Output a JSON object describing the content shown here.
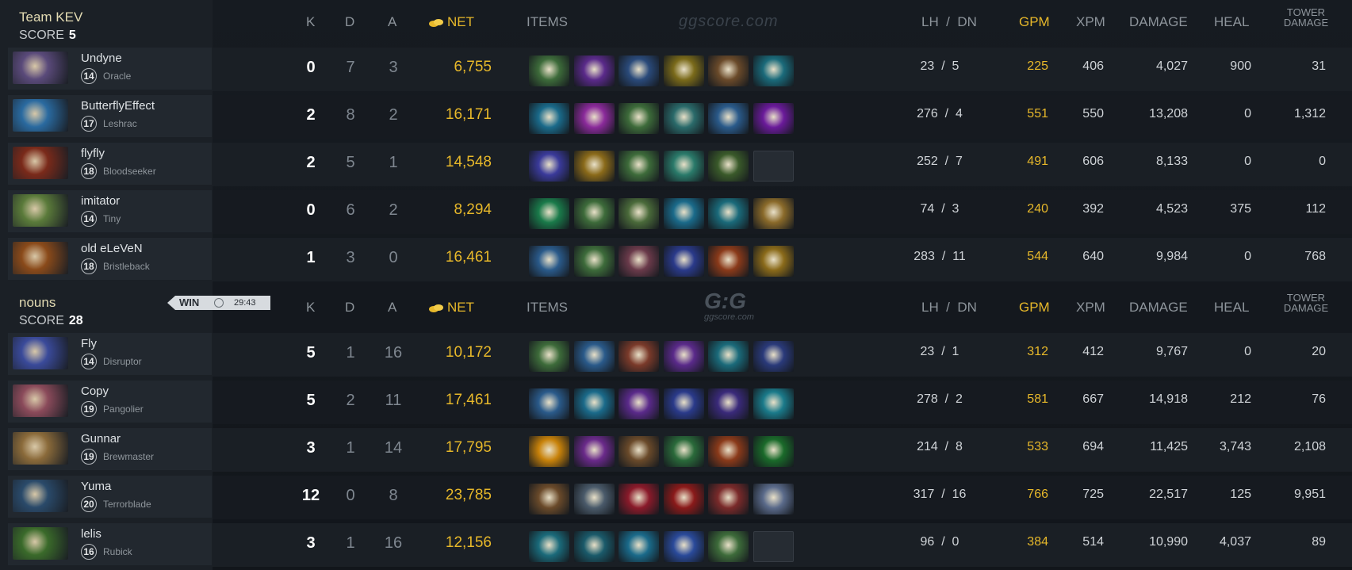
{
  "colors": {
    "gold": "#e7b82a",
    "win_badge": "#d7dbdf"
  },
  "watermark": "ggscore.com",
  "logo": {
    "mark": "G:G",
    "sub": "ggscore.com"
  },
  "win_badge": {
    "label": "WIN",
    "time": "29:43",
    "icon": "clock-icon"
  },
  "columns": {
    "k": "K",
    "d": "D",
    "a": "A",
    "net": "NET",
    "net_icon": "gold-coins-icon",
    "items": "ITEMS",
    "lh_dn": "LH  /  DN",
    "gpm": "GPM",
    "xpm": "XPM",
    "damage": "DAMAGE",
    "heal": "HEAL",
    "tower_damage_1": "TOWER",
    "tower_damage_2": "DAMAGE"
  },
  "teams": [
    {
      "name": "Team  KEV",
      "score_label": "SCORE",
      "score": "5",
      "players": [
        {
          "name": "Undyne",
          "level": "14",
          "hero": "Oracle",
          "hero_color": "#5a4a7a",
          "k": "0",
          "d": "7",
          "a": "3",
          "net": "6,755",
          "lh_dn": "23  /  5",
          "gpm": "225",
          "xpm": "406",
          "damage": "4,027",
          "heal": "900",
          "tower": "31",
          "items": [
            "#3d6b3a",
            "#5a2a8a",
            "#2a4a7a",
            "#7a6a1a",
            "#6a4a2a",
            "#1a6a7a"
          ]
        },
        {
          "name": "ButterflyEffect",
          "level": "17",
          "hero": "Leshrac",
          "hero_color": "#2a6aa0",
          "k": "2",
          "d": "8",
          "a": "2",
          "net": "16,171",
          "lh_dn": "276  /  4",
          "gpm": "551",
          "xpm": "550",
          "damage": "13,208",
          "heal": "0",
          "tower": "1,312",
          "items": [
            "#1a6a8a",
            "#8a2a9a",
            "#3d6b3a",
            "#2a6a6a",
            "#2a5a8a",
            "#6a1a9a"
          ]
        },
        {
          "name": "flyfly",
          "level": "18",
          "hero": "Bloodseeker",
          "hero_color": "#7a2a1a",
          "k": "2",
          "d": "5",
          "a": "1",
          "net": "14,548",
          "lh_dn": "252  /  7",
          "gpm": "491",
          "xpm": "606",
          "damage": "8,133",
          "heal": "0",
          "tower": "0",
          "items": [
            "#3a3a9a",
            "#8a6a1a",
            "#3d6b3a",
            "#2a7a6a",
            "#3a5a2a",
            "empty"
          ]
        },
        {
          "name": "imitator",
          "level": "14",
          "hero": "Tiny",
          "hero_color": "#5a7a3a",
          "k": "0",
          "d": "6",
          "a": "2",
          "net": "8,294",
          "lh_dn": "74  /  3",
          "gpm": "240",
          "xpm": "392",
          "damage": "4,523",
          "heal": "375",
          "tower": "112",
          "items": [
            "#1a7a4a",
            "#3d6b3a",
            "#4a6a3a",
            "#1a6a8a",
            "#1a6a7a",
            "#8a6a2a"
          ]
        },
        {
          "name": "old eLeVeN",
          "level": "18",
          "hero": "Bristleback",
          "hero_color": "#8a4a1a",
          "k": "1",
          "d": "3",
          "a": "0",
          "net": "16,461",
          "lh_dn": "283  /  11",
          "gpm": "544",
          "xpm": "640",
          "damage": "9,984",
          "heal": "0",
          "tower": "768",
          "items": [
            "#2a5a8a",
            "#3d6b3a",
            "#6a3a4a",
            "#2a3a8a",
            "#8a3a1a",
            "#8a6a1a"
          ]
        }
      ]
    },
    {
      "name": "nouns",
      "score_label": "SCORE",
      "score": "28",
      "players": [
        {
          "name": "Fly",
          "level": "14",
          "hero": "Disruptor",
          "hero_color": "#3a4a9a",
          "k": "5",
          "d": "1",
          "a": "16",
          "net": "10,172",
          "lh_dn": "23  /  1",
          "gpm": "312",
          "xpm": "412",
          "damage": "9,767",
          "heal": "0",
          "tower": "20",
          "items": [
            "#3d6b3a",
            "#2a5a8a",
            "#7a3a2a",
            "#5a2a8a",
            "#1a6a7a",
            "#2a3a7a"
          ]
        },
        {
          "name": "Copy",
          "level": "19",
          "hero": "Pangolier",
          "hero_color": "#8a4a5a",
          "k": "5",
          "d": "2",
          "a": "11",
          "net": "17,461",
          "lh_dn": "278  /  2",
          "gpm": "581",
          "xpm": "667",
          "damage": "14,918",
          "heal": "212",
          "tower": "76",
          "items": [
            "#2a5a8a",
            "#1a6a8a",
            "#5a2a8a",
            "#2a3a8a",
            "#3a2a7a",
            "#1a7a8a"
          ]
        },
        {
          "name": "Gunnar",
          "level": "19",
          "hero": "Brewmaster",
          "hero_color": "#8a6a3a",
          "k": "3",
          "d": "1",
          "a": "14",
          "net": "17,795",
          "lh_dn": "214  /  8",
          "gpm": "533",
          "xpm": "694",
          "damage": "11,425",
          "heal": "3,743",
          "tower": "2,108",
          "items": [
            "#c8820a",
            "#6a2a8a",
            "#6a4a2a",
            "#2a6a3a",
            "#8a3a1a",
            "#1a6a2a"
          ]
        },
        {
          "name": "Yuma",
          "level": "20",
          "hero": "Terrorblade",
          "hero_color": "#2a4a6a",
          "k": "12",
          "d": "0",
          "a": "8",
          "net": "23,785",
          "lh_dn": "317  /  16",
          "gpm": "766",
          "xpm": "725",
          "damage": "22,517",
          "heal": "125",
          "tower": "9,951",
          "items": [
            "#6a4a2a",
            "#4a5a6a",
            "#8a1a2a",
            "#8a1a1a",
            "#7a2a2a",
            "#5a6a8a"
          ]
        },
        {
          "name": "lelis",
          "level": "16",
          "hero": "Rubick",
          "hero_color": "#3a6a2a",
          "k": "3",
          "d": "1",
          "a": "16",
          "net": "12,156",
          "lh_dn": "96  /  0",
          "gpm": "384",
          "xpm": "514",
          "damage": "10,990",
          "heal": "4,037",
          "tower": "89",
          "items": [
            "#1a6a7a",
            "#1a5a6a",
            "#1a6a8a",
            "#2a4a9a",
            "#3d6b3a",
            "empty"
          ]
        }
      ]
    }
  ]
}
